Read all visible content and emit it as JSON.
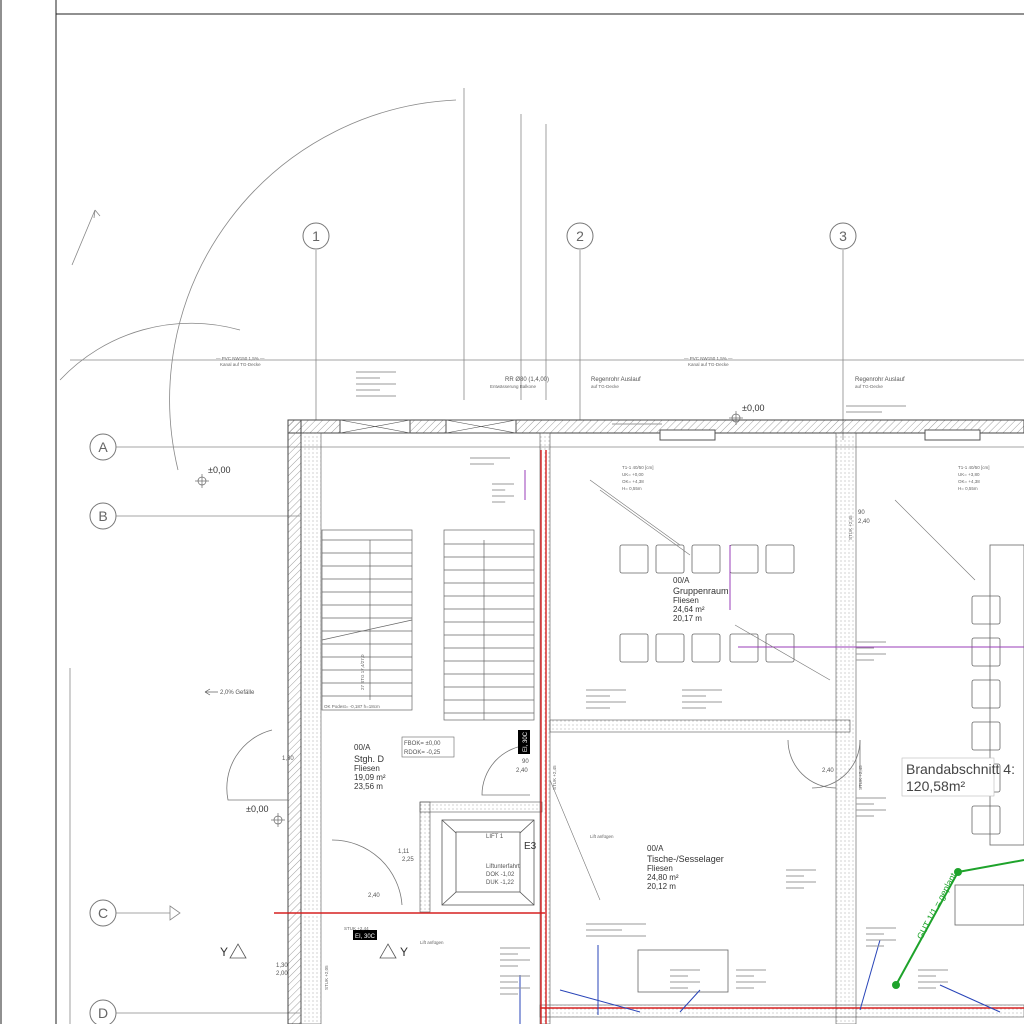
{
  "grid": {
    "columns": [
      "1",
      "2",
      "3"
    ],
    "rows": [
      "A",
      "B",
      "C",
      "D"
    ]
  },
  "levels": {
    "a": "±0,00",
    "b": "±0,00",
    "c": "±0,00"
  },
  "slope": "2,0% Gefälle",
  "rooms": {
    "stair": {
      "code": "00/A",
      "name": "Stgh. D",
      "floor": "Fliesen",
      "area": "19,09 m²",
      "perimeter": "23,56 m"
    },
    "group": {
      "code": "00/A",
      "name": "Gruppenraum",
      "floor": "Fliesen",
      "area": "24,64 m²",
      "perimeter": "20,17 m"
    },
    "storage": {
      "code": "00/A",
      "name": "Tische-/Sesselager",
      "floor": "Fliesen",
      "area": "24,80 m²",
      "perimeter": "20,12 m"
    }
  },
  "fire_section": {
    "line1": "Brandabschnitt 4:",
    "line2": "120,58m²"
  },
  "stair_levels": {
    "fbok": "FBOK= ±0,00",
    "rdok": "RDOK= -0,25"
  },
  "lift": {
    "label": "LIFT 1",
    "note1": "Liftunterfahrt",
    "note2": "DOK -1,02",
    "note3": "DUK -1,22",
    "e3": "E3",
    "saw1": "Lift anfügen",
    "saw2": "Lift anfügen"
  },
  "fire_tag_1": "EI, 30C",
  "fire_tag_2": "EI, 30C",
  "stair_step": "OK Podest= -0,187 h=18cm",
  "stair_count": "27 STG 17,4/27,0",
  "stuk": {
    "a": "STUK +2,45",
    "b": "STUK +2,45",
    "c": "STUK +2,44",
    "d": "STUK +2,45",
    "e": "STUK +2,05"
  },
  "green_label": "GUT 1/1 = geplant",
  "y_mark": "Y",
  "top_notes": {
    "pvc1": "— PVC NW150 1,5% —",
    "pvc1_sub": "Kanal auf TG-Decke",
    "pvc2": "— PVC NW150 1,5% —",
    "pvc2_sub": "Kanal auf TG-Decke",
    "rain1": "Regenrohr Auslauf",
    "rain1_sub": "auf TG-Decke",
    "rain2": "Regenrohr Auslauf",
    "rain2_sub": "auf TG-Decke",
    "rr": "RR Ø80 (1,4,00)",
    "rr_sub": "Entwässerung Balkone"
  },
  "window_tags": {
    "t1": "T1-1 40/50 [cm]",
    "t1_uk": "UK= +0,00",
    "t1_ok": "OK= +4,38",
    "t1_h": "H= 0,55m",
    "t2": "T1-1 40/50 [cm]",
    "t2_uk": "UK= +3,80",
    "t2_ok": "OK= +4,38",
    "t2_h": "H= 0,55m"
  },
  "dims": {
    "d1": "90",
    "d2": "2,40",
    "d3": "1,11",
    "d4": "2,25",
    "d5": "90",
    "d6": "2,40",
    "d7": "1,30",
    "d8": "2,00",
    "d9": "1,30",
    "d10": "2,40",
    "d11": "2,40"
  }
}
